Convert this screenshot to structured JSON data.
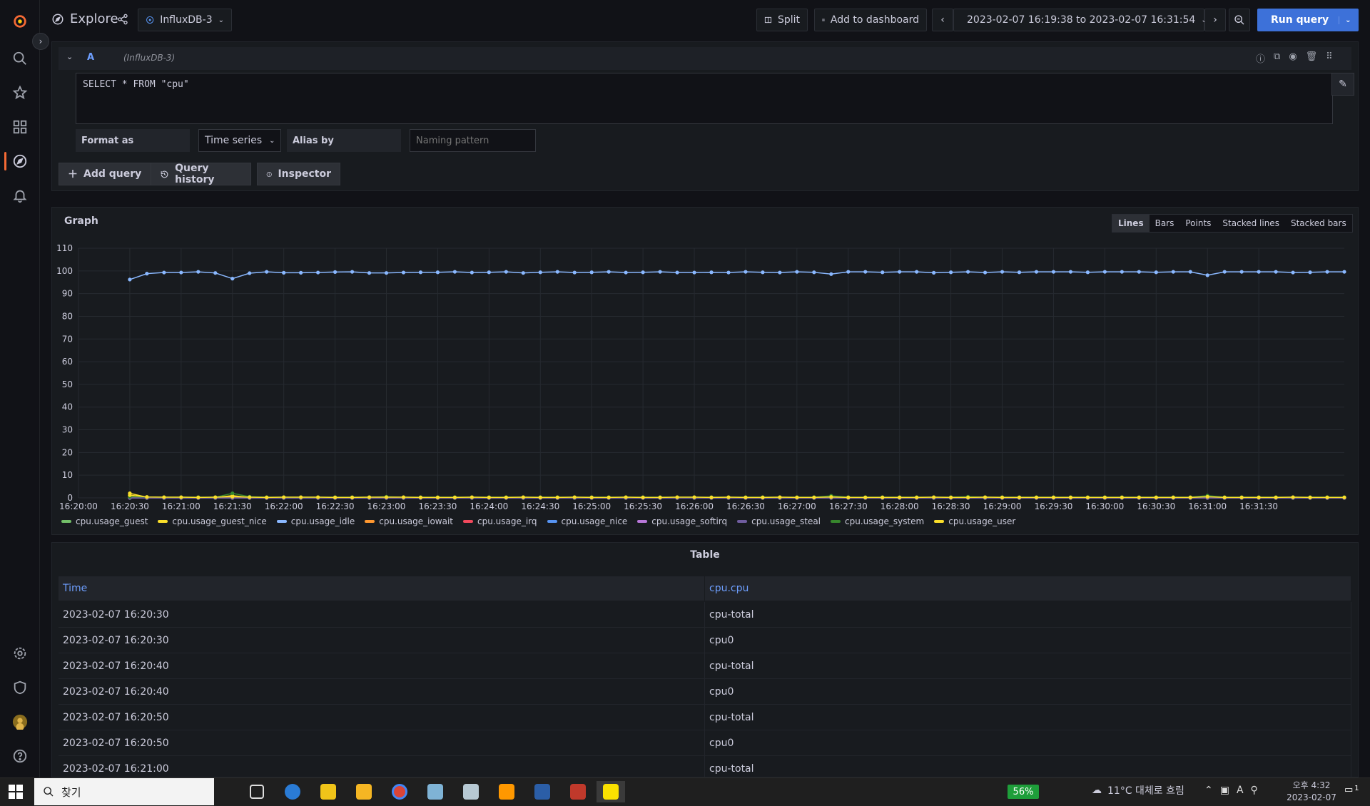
{
  "sidebar": {
    "items": [
      "grafana-logo-icon",
      "search-icon",
      "star-icon",
      "dashboards-icon",
      "explore-icon",
      "alerting-icon"
    ],
    "bottom_items": [
      "gear-icon",
      "shield-icon",
      "avatar",
      "help-icon"
    ],
    "active_color": "#f56a35"
  },
  "header": {
    "title": "Explore",
    "datasource": "InfluxDB-3",
    "split_label": "Split",
    "add_to_dashboard_label": "Add to dashboard",
    "time_range": "2023-02-07 16:19:38 to 2023-02-07 16:31:54",
    "run_query_label": "Run query"
  },
  "query": {
    "ref_id": "A",
    "datasource": "(InfluxDB-3)",
    "sql": "SELECT * FROM \"cpu\"",
    "format_as_label": "Format as",
    "format_as_value": "Time series",
    "alias_by_label": "Alias by",
    "naming_pattern_placeholder": "Naming pattern",
    "add_query_label": "Add query",
    "query_history_label": "Query history",
    "inspector_label": "Inspector"
  },
  "graph": {
    "title": "Graph",
    "modes": [
      "Lines",
      "Bars",
      "Points",
      "Stacked lines",
      "Stacked bars"
    ],
    "active_mode": "Lines"
  },
  "chart_data": {
    "type": "line",
    "title": "Graph",
    "x_ticks": [
      "16:20:00",
      "16:20:30",
      "16:21:00",
      "16:21:30",
      "16:22:00",
      "16:22:30",
      "16:23:00",
      "16:23:30",
      "16:24:00",
      "16:24:30",
      "16:25:00",
      "16:25:30",
      "16:26:00",
      "16:26:30",
      "16:27:00",
      "16:27:30",
      "16:28:00",
      "16:28:30",
      "16:29:00",
      "16:29:30",
      "16:30:00",
      "16:30:30",
      "16:31:00",
      "16:31:30"
    ],
    "y_ticks": [
      0,
      10,
      20,
      30,
      40,
      50,
      60,
      70,
      80,
      90,
      100,
      110
    ],
    "ylim": [
      0,
      110
    ],
    "x_start": "16:20:30",
    "x_step_seconds": 10,
    "legend_placement": "bottom-left",
    "grid": true,
    "series": [
      {
        "name": "cpu.usage_guest",
        "color": "#73bf69",
        "values": [
          1.0,
          0.3,
          0.2,
          0.2,
          0.2,
          0.2,
          0.2,
          0.2,
          0.2,
          0.2,
          0.2,
          0.2,
          0.2,
          0.2,
          0.2,
          0.2,
          0.2,
          0.2,
          0.2,
          0.2,
          0.2,
          0.2,
          0.2,
          0.2,
          0.2,
          0.2,
          0.2,
          0.2,
          0.2,
          0.2,
          0.2,
          0.2,
          0.2,
          0.2,
          0.2,
          0.2,
          0.2,
          0.2,
          0.2,
          0.2,
          0.2,
          0.2,
          0.2,
          0.2,
          0.2,
          0.2,
          0.2,
          0.2,
          0.2,
          0.2,
          0.2,
          0.2,
          0.2,
          0.2,
          0.2,
          0.2,
          0.2,
          0.2,
          0.2,
          0.2,
          0.2,
          0.2,
          0.2,
          0.2,
          0.2,
          0.2,
          0.2,
          0.2,
          0.2,
          0.2,
          0.2,
          0.2
        ]
      },
      {
        "name": "cpu.usage_guest_nice",
        "color": "#fade2a",
        "values": [
          2.0,
          0.3,
          0.2,
          0.2,
          0.2,
          0.2,
          1.0,
          0.2,
          0.2,
          0.2,
          0.2,
          0.2,
          0.2,
          0.2,
          0.2,
          0.2,
          0.2,
          0.2,
          0.2,
          0.2,
          0.2,
          0.2,
          0.2,
          0.2,
          0.2,
          0.2,
          0.2,
          0.2,
          0.2,
          0.2,
          0.2,
          0.2,
          0.2,
          0.2,
          0.2,
          0.2,
          0.2,
          0.2,
          0.2,
          0.2,
          0.2,
          0.2,
          0.2,
          0.2,
          0.2,
          0.2,
          0.2,
          0.2,
          0.2,
          0.2,
          0.2,
          0.2,
          0.2,
          0.2,
          0.2,
          0.2,
          0.2,
          0.2,
          0.2,
          0.2,
          0.2,
          0.2,
          0.2,
          0.2,
          0.2,
          0.2,
          0.2,
          0.2,
          0.2,
          0.2,
          0.2,
          0.2
        ]
      },
      {
        "name": "cpu.usage_idle",
        "color": "#8ab8ff",
        "values": [
          96.2,
          98.8,
          99.3,
          99.3,
          99.6,
          99.1,
          96.6,
          99.0,
          99.6,
          99.2,
          99.2,
          99.3,
          99.5,
          99.6,
          99.1,
          99.1,
          99.3,
          99.4,
          99.4,
          99.6,
          99.3,
          99.4,
          99.6,
          99.1,
          99.4,
          99.6,
          99.3,
          99.4,
          99.6,
          99.3,
          99.4,
          99.6,
          99.3,
          99.3,
          99.4,
          99.3,
          99.6,
          99.4,
          99.3,
          99.6,
          99.4,
          98.6,
          99.6,
          99.6,
          99.4,
          99.6,
          99.6,
          99.2,
          99.4,
          99.6,
          99.3,
          99.6,
          99.4,
          99.6,
          99.6,
          99.6,
          99.4,
          99.6,
          99.6,
          99.6,
          99.4,
          99.6,
          99.6,
          98.1,
          99.6,
          99.6,
          99.6,
          99.6,
          99.3,
          99.4,
          99.6,
          99.6
        ]
      },
      {
        "name": "cpu.usage_iowait",
        "color": "#ff9830",
        "values": [
          0.8,
          0.1,
          0.1,
          0.1,
          0.1,
          0.1,
          0.4,
          0.1,
          0.1,
          0.1,
          0.1,
          0.1,
          0.1,
          0.1,
          0.1,
          0.1,
          0.1,
          0.1,
          0.1,
          0.1,
          0.1,
          0.1,
          0.1,
          0.1,
          0.1,
          0.1,
          0.1,
          0.1,
          0.1,
          0.1,
          0.1,
          0.1,
          0.1,
          0.1,
          0.1,
          0.1,
          0.1,
          0.1,
          0.1,
          0.1,
          0.1,
          0.1,
          0.1,
          0.1,
          0.1,
          0.1,
          0.1,
          0.1,
          0.1,
          0.1,
          0.1,
          0.1,
          0.1,
          0.1,
          0.1,
          0.1,
          0.1,
          0.1,
          0.1,
          0.1,
          0.1,
          0.1,
          0.1,
          0.1,
          0.1,
          0.1,
          0.1,
          0.1,
          0.1,
          0.1,
          0.1,
          0.1
        ]
      },
      {
        "name": "cpu.usage_irq",
        "color": "#f2495c",
        "values": [
          0,
          0,
          0,
          0,
          0,
          0,
          0,
          0,
          0,
          0,
          0,
          0,
          0,
          0,
          0,
          0,
          0,
          0,
          0,
          0,
          0,
          0,
          0,
          0,
          0,
          0,
          0,
          0,
          0,
          0,
          0,
          0,
          0,
          0,
          0,
          0,
          0,
          0,
          0,
          0,
          0,
          0,
          0,
          0,
          0,
          0,
          0,
          0,
          0,
          0,
          0,
          0,
          0,
          0,
          0,
          0,
          0,
          0,
          0,
          0,
          0,
          0,
          0,
          0,
          0,
          0,
          0,
          0,
          0,
          0,
          0,
          0
        ]
      },
      {
        "name": "cpu.usage_nice",
        "color": "#5794f2",
        "values": [
          0,
          0,
          0,
          0,
          0,
          0,
          0,
          0,
          0,
          0,
          0,
          0,
          0,
          0,
          0,
          0,
          0,
          0,
          0,
          0,
          0,
          0,
          0,
          0,
          0,
          0,
          0,
          0,
          0,
          0,
          0,
          0,
          0,
          0,
          0,
          0,
          0,
          0,
          0,
          0,
          0,
          0,
          0,
          0,
          0,
          0,
          0,
          0,
          0,
          0,
          0,
          0,
          0,
          0,
          0,
          0,
          0,
          0,
          0,
          0,
          0,
          0,
          0,
          0,
          0,
          0,
          0,
          0,
          0,
          0,
          0,
          0
        ]
      },
      {
        "name": "cpu.usage_softirq",
        "color": "#b877d9",
        "values": [
          0,
          0,
          0,
          0,
          0,
          0,
          0,
          0,
          0,
          0,
          0,
          0,
          0,
          0,
          0,
          0,
          0,
          0,
          0,
          0,
          0,
          0,
          0,
          0,
          0,
          0,
          0,
          0,
          0,
          0,
          0,
          0,
          0,
          0,
          0,
          0,
          0,
          0,
          0,
          0,
          0,
          0,
          0,
          0,
          0,
          0,
          0,
          0,
          0,
          0,
          0,
          0,
          0,
          0,
          0,
          0,
          0,
          0,
          0,
          0,
          0,
          0,
          0,
          0,
          0,
          0,
          0,
          0,
          0,
          0,
          0,
          0
        ]
      },
      {
        "name": "cpu.usage_steal",
        "color": "#705da0",
        "values": [
          0,
          0,
          0,
          0,
          0,
          0,
          0,
          0,
          0,
          0,
          0,
          0,
          0,
          0,
          0,
          0,
          0,
          0,
          0,
          0,
          0,
          0,
          0,
          0,
          0,
          0,
          0,
          0,
          0,
          0,
          0,
          0,
          0,
          0,
          0,
          0,
          0,
          0,
          0,
          0,
          0,
          0,
          0,
          0,
          0,
          0,
          0,
          0,
          0,
          0,
          0,
          0,
          0,
          0,
          0,
          0,
          0,
          0,
          0,
          0,
          0,
          0,
          0,
          0,
          0,
          0,
          0,
          0,
          0,
          0,
          0,
          0
        ]
      },
      {
        "name": "cpu.usage_system",
        "color": "#37872d",
        "values": [
          0.5,
          0.4,
          0.3,
          0.3,
          0.3,
          0.3,
          2.0,
          0.5,
          0.3,
          0.3,
          0.3,
          0.3,
          0.3,
          0.3,
          0.3,
          0.5,
          0.3,
          0.3,
          0.3,
          0.3,
          0.3,
          0.3,
          0.3,
          0.3,
          0.3,
          0.3,
          0.3,
          0.3,
          0.3,
          0.3,
          0.3,
          0.3,
          0.3,
          0.3,
          0.3,
          0.3,
          0.3,
          0.3,
          0.3,
          0.3,
          0.3,
          0.9,
          0.3,
          0.3,
          0.3,
          0.3,
          0.3,
          0.3,
          0.3,
          0.5,
          0.3,
          0.3,
          0.3,
          0.3,
          0.3,
          0.3,
          0.3,
          0.3,
          0.3,
          0.3,
          0.3,
          0.3,
          0.3,
          1.0,
          0.3,
          0.3,
          0.3,
          0.3,
          0.3,
          0.3,
          0.3,
          0.3
        ]
      },
      {
        "name": "cpu.usage_user",
        "color": "#fade2a",
        "values": [
          1.2,
          0.4,
          0.3,
          0.3,
          0.2,
          0.3,
          0.5,
          0.3,
          0.2,
          0.3,
          0.3,
          0.3,
          0.2,
          0.2,
          0.3,
          0.3,
          0.3,
          0.2,
          0.2,
          0.2,
          0.3,
          0.2,
          0.2,
          0.3,
          0.2,
          0.2,
          0.3,
          0.2,
          0.2,
          0.3,
          0.2,
          0.2,
          0.3,
          0.3,
          0.2,
          0.3,
          0.2,
          0.2,
          0.3,
          0.2,
          0.2,
          0.4,
          0.2,
          0.2,
          0.2,
          0.2,
          0.2,
          0.3,
          0.2,
          0.2,
          0.3,
          0.2,
          0.2,
          0.2,
          0.2,
          0.2,
          0.2,
          0.2,
          0.2,
          0.2,
          0.2,
          0.2,
          0.2,
          0.5,
          0.2,
          0.2,
          0.2,
          0.2,
          0.3,
          0.2,
          0.2,
          0.2
        ]
      }
    ]
  },
  "table": {
    "title": "Table",
    "columns": [
      "Time",
      "cpu.cpu"
    ],
    "rows": [
      [
        "2023-02-07 16:20:30",
        "cpu-total"
      ],
      [
        "2023-02-07 16:20:30",
        "cpu0"
      ],
      [
        "2023-02-07 16:20:40",
        "cpu-total"
      ],
      [
        "2023-02-07 16:20:40",
        "cpu0"
      ],
      [
        "2023-02-07 16:20:50",
        "cpu-total"
      ],
      [
        "2023-02-07 16:20:50",
        "cpu0"
      ],
      [
        "2023-02-07 16:21:00",
        "cpu-total"
      ]
    ]
  },
  "taskbar": {
    "search_placeholder": "찾기",
    "battery": "56%",
    "weather": "11°C 대체로 흐림",
    "clock_time": "오후 4:32",
    "clock_date": "2023-02-07",
    "notification_count": "1"
  }
}
